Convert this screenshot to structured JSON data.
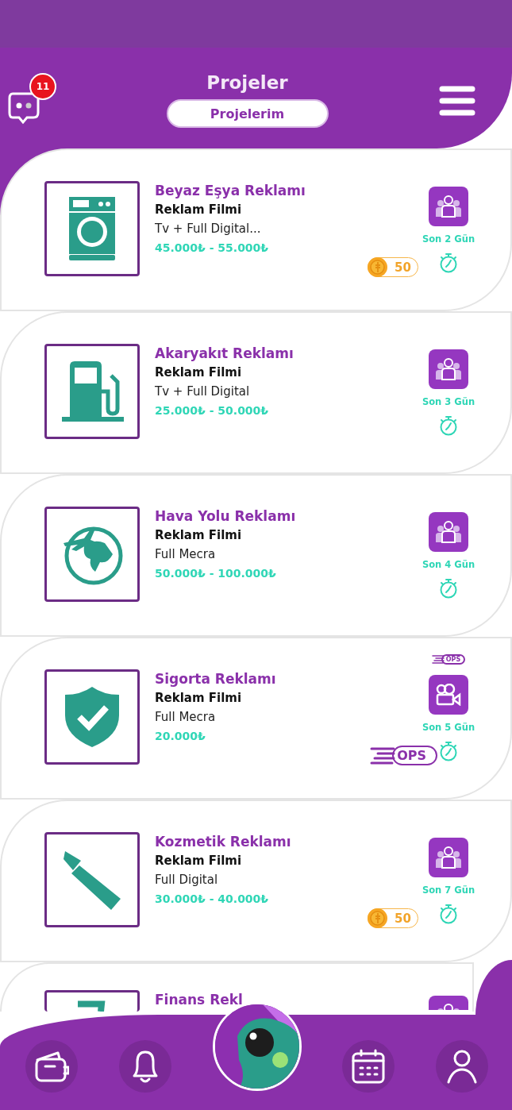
{
  "header": {
    "title": "Projeler",
    "tab": "Projelerim",
    "messages_badge": "11"
  },
  "projects": [
    {
      "image": {
        "kind": "washer"
      },
      "title": "Beyaz Eşya Reklamı",
      "type": "Reklam Filmi",
      "media": "Tv + Full Digital...",
      "price": "45.000₺ - 55.000₺",
      "badge": {
        "kind": "coin",
        "text": "50"
      },
      "action": {
        "kind": "team"
      },
      "deadline": "Son 2 Gün"
    },
    {
      "image": {
        "kind": "fuel"
      },
      "title": "Akaryakıt Reklamı",
      "type": "Reklam Filmi",
      "media": "Tv + Full Digital",
      "price": "25.000₺ - 50.000₺",
      "action": {
        "kind": "team"
      },
      "deadline": "Son 3 Gün"
    },
    {
      "image": {
        "kind": "globe"
      },
      "title": "Hava Yolu Reklamı",
      "type": "Reklam Filmi",
      "media": "Full Mecra",
      "price": "50.000₺ - 100.000₺",
      "action": {
        "kind": "team"
      },
      "deadline": "Son 4 Gün"
    },
    {
      "image": {
        "kind": "shield"
      },
      "title": "Sigorta Reklamı",
      "type": "Reklam Filmi",
      "media": "Full Mecra",
      "price": "20.000₺",
      "badge": {
        "kind": "ops",
        "text": "OPS"
      },
      "tag": "OPS",
      "action": {
        "kind": "camera"
      },
      "deadline": "Son 5 Gün"
    },
    {
      "image": {
        "kind": "lipstick"
      },
      "title": "Kozmetik Reklamı",
      "type": "Reklam Filmi",
      "media": "Full Digital",
      "price": "30.000₺ - 40.000₺",
      "badge": {
        "kind": "coin",
        "text": "50"
      },
      "action": {
        "kind": "team"
      },
      "deadline": "Son 7 Gün"
    },
    {
      "image": {
        "kind": "chart"
      },
      "title": "Finans Rekl",
      "action": {
        "kind": "team"
      },
      "cut": true
    }
  ],
  "nav": [
    {
      "kind": "wallet"
    },
    {
      "kind": "bell"
    },
    {
      "kind": "mascot"
    },
    {
      "kind": "calendar"
    },
    {
      "kind": "user"
    }
  ]
}
